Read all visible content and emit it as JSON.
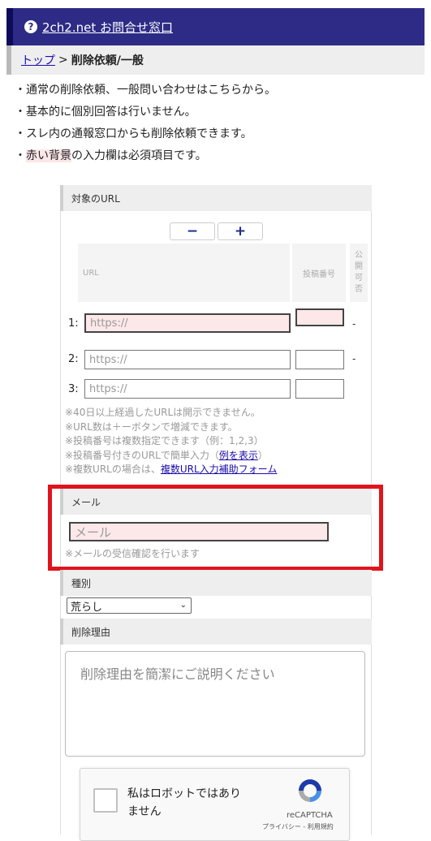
{
  "header": {
    "icon": "question-circle-icon",
    "title": "2ch2.net お問合せ窓口"
  },
  "breadcrumb": {
    "home": "トップ",
    "separator": ">",
    "current": "削除依頼/一般"
  },
  "notes": [
    "・通常の削除依頼、一般問い合わせはこちらから。",
    "・基本的に個別回答は行いません。",
    "・スレ内の通報窓口からも削除依頼できます。",
    {
      "prefix": "・",
      "highlight": "赤い背景",
      "suffix": "の入力欄は必須項目です。"
    }
  ],
  "url_section": {
    "heading": "対象のURL",
    "minus_label": "−",
    "plus_label": "+",
    "columns": {
      "url": "URL",
      "post_number": "投稿番号",
      "public": "公開可否"
    },
    "rows": [
      {
        "num": "1:",
        "placeholder": "https://",
        "public": "-"
      },
      {
        "num": "2:",
        "placeholder": "https://",
        "public": "-"
      },
      {
        "num": "3:",
        "placeholder": "https://",
        "public": ""
      }
    ],
    "hints": [
      "※40日以上経過したURLは開示できません。",
      "※URL数は＋ーボタンで増減できます。",
      "※投稿番号は複数指定できます（例：1,2,3）",
      {
        "text": "※投稿番号付きのURLで簡単入力（",
        "link": "例を表示",
        "after": "）"
      },
      {
        "text": "※複数URLの場合は、",
        "link": "複数URL入力補助フォーム",
        "after": ""
      }
    ]
  },
  "mail_section": {
    "heading": "メール",
    "placeholder": "メール",
    "hint": "※メールの受信確認を行います"
  },
  "type_section": {
    "heading": "種別",
    "selected": "荒らし"
  },
  "reason_section": {
    "heading": "削除理由",
    "placeholder": "削除理由を簡潔にご説明ください"
  },
  "captcha": {
    "label_line1": "私はロボットではあり",
    "label_line2": "ません",
    "brand": "reCAPTCHA",
    "terms": "プライバシー - 利用規約"
  },
  "colors": {
    "header_bg": "#2d2b86",
    "required_bg": "#fde8e9",
    "highlight_box": "#e0141c",
    "link": "#1a0dab"
  }
}
